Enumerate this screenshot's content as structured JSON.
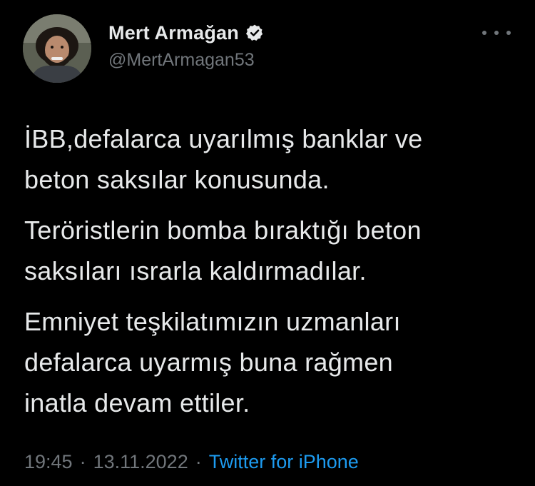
{
  "user": {
    "display_name": "Mert Armağan",
    "handle": "@MertArmagan53",
    "verified": true
  },
  "tweet": {
    "paragraphs": [
      "İBB,defalarca uyarılmış banklar ve\nbeton saksılar konusunda.",
      "Teröristlerin bomba bıraktığı beton\nsaksıları ısrarla kaldırmadılar.",
      "Emniyet teşkilatımızın uzmanları\ndefalarca uyarmış buna rağmen\ninatla devam ettiler."
    ],
    "time": "19:45",
    "date": "13.11.2022",
    "separator": "·",
    "source": "Twitter for iPhone"
  },
  "icons": {
    "verified": "verified-badge-icon",
    "more": "more-options-icon"
  },
  "colors": {
    "background": "#000000",
    "text": "#e7e9ea",
    "secondary": "#71767b",
    "link": "#1d9bf0"
  }
}
